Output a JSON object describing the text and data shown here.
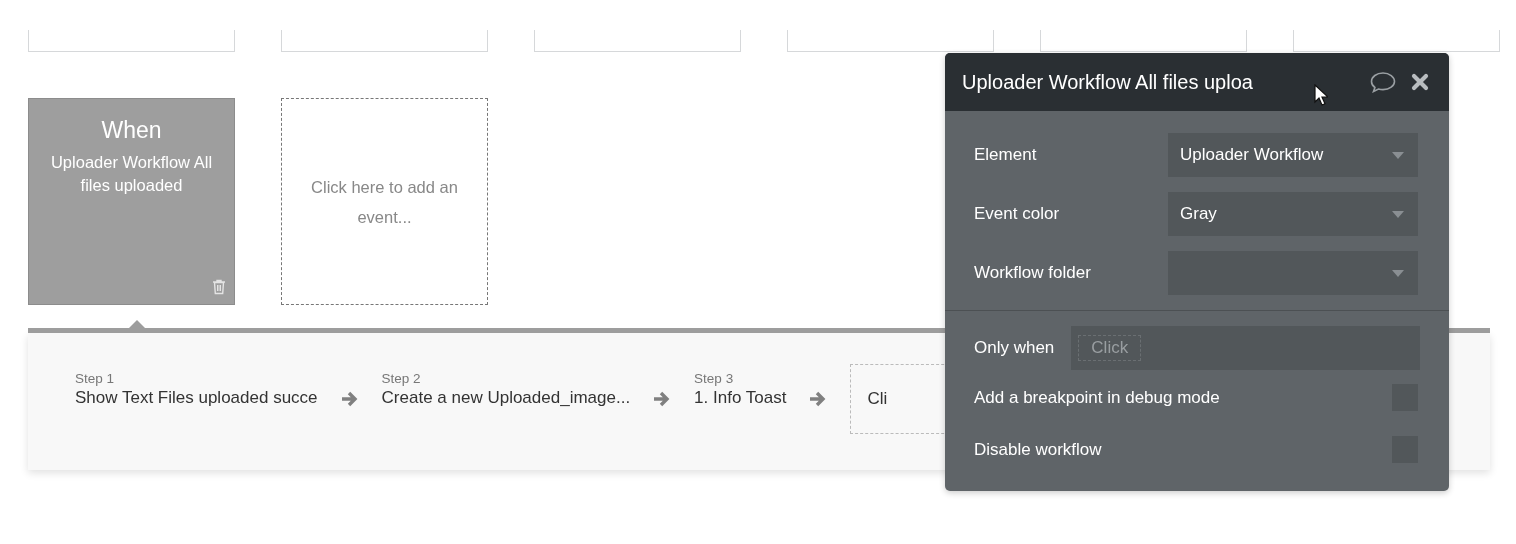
{
  "top_cards": [
    {
      "kind": "event"
    },
    {
      "kind": "event"
    },
    {
      "kind": "event"
    },
    {
      "kind": "event"
    },
    {
      "kind": "event"
    },
    {
      "kind": "event"
    }
  ],
  "events": [
    {
      "kind": "event",
      "heading": "When",
      "name": "Uploader Workflow All files uploaded",
      "selected": true
    },
    {
      "kind": "add",
      "text": "Click here to add an event..."
    }
  ],
  "steps": [
    {
      "kind": "step",
      "label": "Step 1",
      "text": "Show Text Files uploaded succe"
    },
    {
      "kind": "step",
      "label": "Step 2",
      "text": "Create a new Uploaded_image..."
    },
    {
      "kind": "step",
      "label": "Step 3",
      "text": "1. Info Toast"
    },
    {
      "kind": "add",
      "text": "Cli"
    }
  ],
  "popup": {
    "title": "Uploader Workflow All files uploa",
    "fields": [
      {
        "kind": "dropdown",
        "label": "Element",
        "value": "Uploader Workflow"
      },
      {
        "kind": "dropdown",
        "label": "Event color",
        "value": "Gray"
      },
      {
        "kind": "dropdown",
        "label": "Workflow folder"
      },
      {
        "kind": "condition",
        "label": "Only when",
        "placeholder": "Click"
      },
      {
        "kind": "checkbox",
        "label": "Add a breakpoint in debug mode",
        "checked": false
      },
      {
        "kind": "checkbox",
        "label": "Disable workflow",
        "checked": false
      }
    ]
  }
}
